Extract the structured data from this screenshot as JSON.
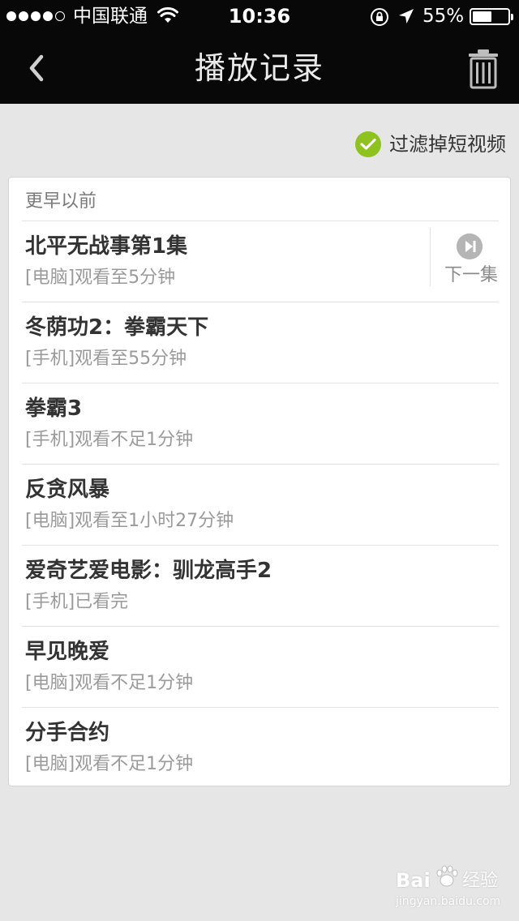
{
  "status_bar": {
    "carrier": "中国联通",
    "time": "10:36",
    "battery": "55%",
    "battery_level": 0.55,
    "signal_bars": 4
  },
  "nav": {
    "title": "播放记录",
    "back_icon": "chevron-left-icon",
    "trash_icon": "trash-icon"
  },
  "filter": {
    "label": "过滤掉短视频",
    "checked": true,
    "accent": "#8ec21f"
  },
  "section": {
    "header": "更早以前",
    "items": [
      {
        "title": "北平无战事第1集",
        "subtitle": "[电脑]观看至5分钟",
        "next_label": "下一集"
      },
      {
        "title": "冬荫功2：拳霸天下",
        "subtitle": "[手机]观看至55分钟"
      },
      {
        "title": "拳霸3",
        "subtitle": "[手机]观看不足1分钟"
      },
      {
        "title": "反贪风暴",
        "subtitle": "[电脑]观看至1小时27分钟"
      },
      {
        "title": "爱奇艺爱电影：驯龙高手2",
        "subtitle": "[手机]已看完"
      },
      {
        "title": "早见晚爱",
        "subtitle": "[电脑]观看不足1分钟"
      },
      {
        "title": "分手合约",
        "subtitle": "[电脑]观看不足1分钟"
      }
    ]
  },
  "watermark": {
    "brand_left": "Bai",
    "brand_right": "经验",
    "url": "jingyan.baidu.com"
  }
}
